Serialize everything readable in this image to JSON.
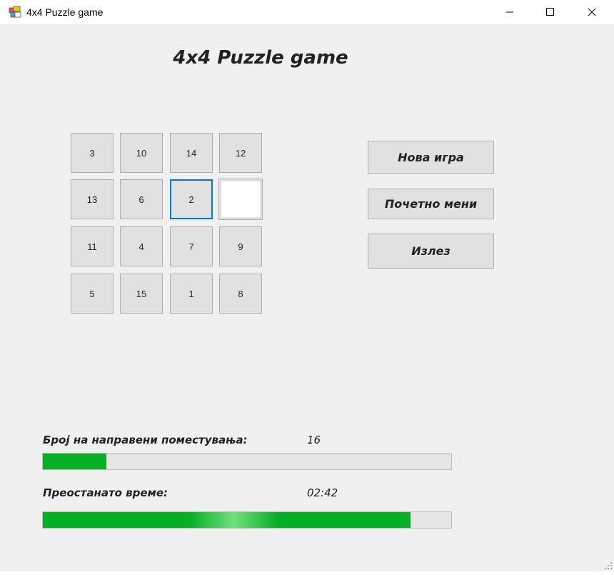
{
  "window": {
    "title": "4x4 Puzzle game"
  },
  "heading": "4x4 Puzzle game",
  "board": {
    "tiles": [
      {
        "label": "3"
      },
      {
        "label": "10"
      },
      {
        "label": "14"
      },
      {
        "label": "12"
      },
      {
        "label": "13"
      },
      {
        "label": "6"
      },
      {
        "label": "2",
        "selected": true
      },
      {
        "label": "",
        "empty": true
      },
      {
        "label": "11"
      },
      {
        "label": "4"
      },
      {
        "label": "7"
      },
      {
        "label": "9"
      },
      {
        "label": "5"
      },
      {
        "label": "15"
      },
      {
        "label": "1"
      },
      {
        "label": "8"
      }
    ]
  },
  "actions": {
    "new_game": "Нова игра",
    "main_menu": "Почетно мени",
    "exit": "Излез"
  },
  "stats": {
    "moves_label": "Број на направени поместувања:",
    "moves_value": "16",
    "moves_progress": 0.155,
    "time_label": "Преостанато време:",
    "time_value": "02:42",
    "time_progress": 0.9
  },
  "colors": {
    "progress": "#06b025",
    "selected_border": "#0078d7"
  }
}
